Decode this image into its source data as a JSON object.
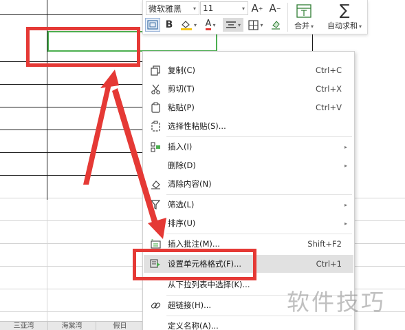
{
  "toolbar": {
    "font_name": "微软雅黑",
    "font_size": "11",
    "grow_font": "A",
    "shrink_font": "A",
    "bold": "B",
    "font_color": "A",
    "merge_label": "合并",
    "autosum_label": "自动求和",
    "icons": [
      "format-painter-icon",
      "fill-color-icon",
      "font-color-icon",
      "align-icon",
      "border-icon",
      "clear-format-icon",
      "merge-icon",
      "sigma-icon"
    ]
  },
  "context_menu": {
    "items": [
      {
        "label": "复制(C)",
        "shortcut": "Ctrl+C",
        "icon": "copy-icon"
      },
      {
        "label": "剪切(T)",
        "shortcut": "Ctrl+X",
        "icon": "cut-icon"
      },
      {
        "label": "粘贴(P)",
        "shortcut": "Ctrl+V",
        "icon": "paste-icon"
      },
      {
        "label": "选择性粘贴(S)...",
        "shortcut": "",
        "icon": "paste-special-icon"
      },
      {
        "label": "插入(I)",
        "shortcut": "",
        "icon": "insert-icon",
        "submenu": true
      },
      {
        "label": "删除(D)",
        "shortcut": "",
        "icon": "",
        "submenu": true
      },
      {
        "label": "清除内容(N)",
        "shortcut": "",
        "icon": "eraser-icon"
      },
      {
        "label": "筛选(L)",
        "shortcut": "",
        "icon": "filter-icon",
        "submenu": true
      },
      {
        "label": "排序(U)",
        "shortcut": "",
        "icon": "sort-icon",
        "submenu": true
      },
      {
        "label": "插入批注(M)...",
        "shortcut": "Shift+F2",
        "icon": "comment-icon"
      },
      {
        "label": "设置单元格格式(F)...",
        "shortcut": "Ctrl+1",
        "icon": "format-cells-icon",
        "highlighted": true
      },
      {
        "label": "从下拉列表中选择(K)...",
        "shortcut": "",
        "icon": ""
      },
      {
        "label": "超链接(H)...",
        "shortcut": "",
        "icon": "link-icon"
      },
      {
        "label": "定义名称(A)...",
        "shortcut": "",
        "icon": ""
      }
    ]
  },
  "sheet_tabs": [
    "三亚湾",
    "海棠湾",
    "假日"
  ],
  "watermark": "软件技巧",
  "colors": {
    "annotation_red": "#e53935",
    "active_cell_border": "#4caf50",
    "menu_highlight": "#e1e1e1"
  }
}
